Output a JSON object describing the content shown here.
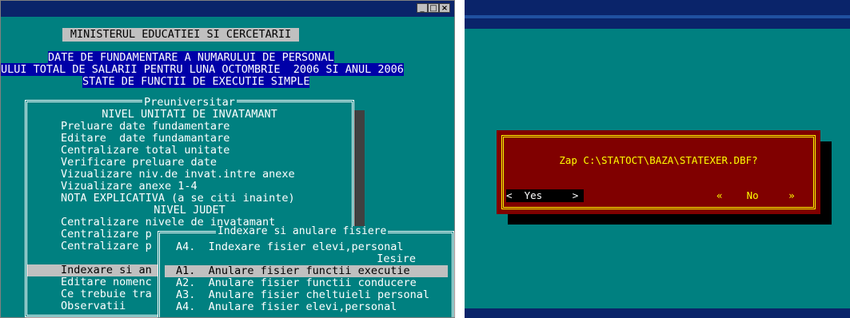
{
  "left_window": {
    "titlebar_buttons": [
      "_",
      "□",
      "×"
    ],
    "ministry_title": "MINISTERUL EDUCATIEI SI CERCETARII",
    "header_lines": [
      "DATE DE FUNDAMENTARE A NUMARULUI DE PERSONAL",
      "ULUI TOTAL DE SALARII PENTRU LUNA OCTOMBRIE  2006 SI ANUL 2006",
      "STATE DE FUNCTII DE EXECUTIE SIMPLE"
    ],
    "menu": {
      "title": "Preuniversitar",
      "section1": "NIVEL UNITATI DE INVATAMANT",
      "items1": [
        "Preluare date fundamentare",
        "Editare  date fundamantare",
        "Centralizare total unitate",
        "Verificare preluare date",
        "Vizualizare niv.de invat.intre anexe",
        "Vizualizare anexe 1-4",
        "NOTA EXPLICATIVA (a se citi inainte)"
      ],
      "section2": "NIVEL JUDET",
      "items2": [
        "Centralizare nivele de invatamant",
        "Centralizare p",
        "Centralizare p"
      ],
      "items3": [
        "Indexare si an",
        "Editare nomenc",
        "Ce trebuie tra",
        "Observatii"
      ]
    },
    "submenu": {
      "title": "Indexare si anulare fisiere",
      "items": [
        "A4.  Indexare fisier elevi,personal",
        "Iesire",
        "A1.  Anulare fisier functii executie",
        "A2.  Anulare fisier functii conducere",
        "A3.  Anulare fisier cheltuieli personal",
        "A4.  Anulare fisier elevi,personal"
      ]
    }
  },
  "right_window": {
    "dialog": {
      "message": "Zap C:\\STATOCT\\BAZA\\STATEXER.DBF?",
      "yes_label": "<  Yes     >",
      "no_label": "«    No     »"
    }
  },
  "colors": {
    "screen_bg": "#008080",
    "titlebar": "#0a246a",
    "dialog_bg": "#800000",
    "dialog_accent": "#ffff00"
  }
}
